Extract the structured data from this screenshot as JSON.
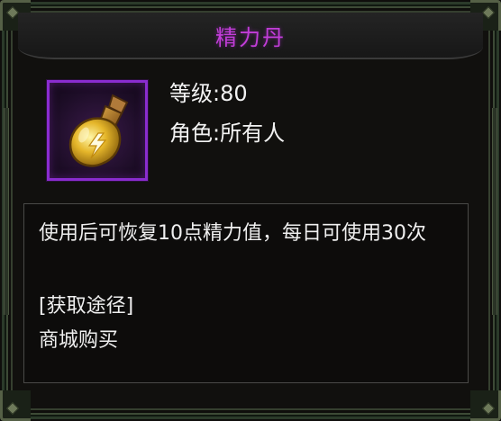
{
  "item": {
    "name": "精力丹",
    "level_label": "等级:80",
    "role_label": "角色:所有人",
    "icon": "energy-potion-icon"
  },
  "description": {
    "text": "使用后可恢复10点精力值，每日可使用30次",
    "source_heading": "[获取途径]",
    "source_value": "商城购买"
  },
  "colors": {
    "title": "#c23dd8",
    "icon_border": "#8a2ccf",
    "text": "#efefef",
    "frame": "#2b3a2a"
  }
}
